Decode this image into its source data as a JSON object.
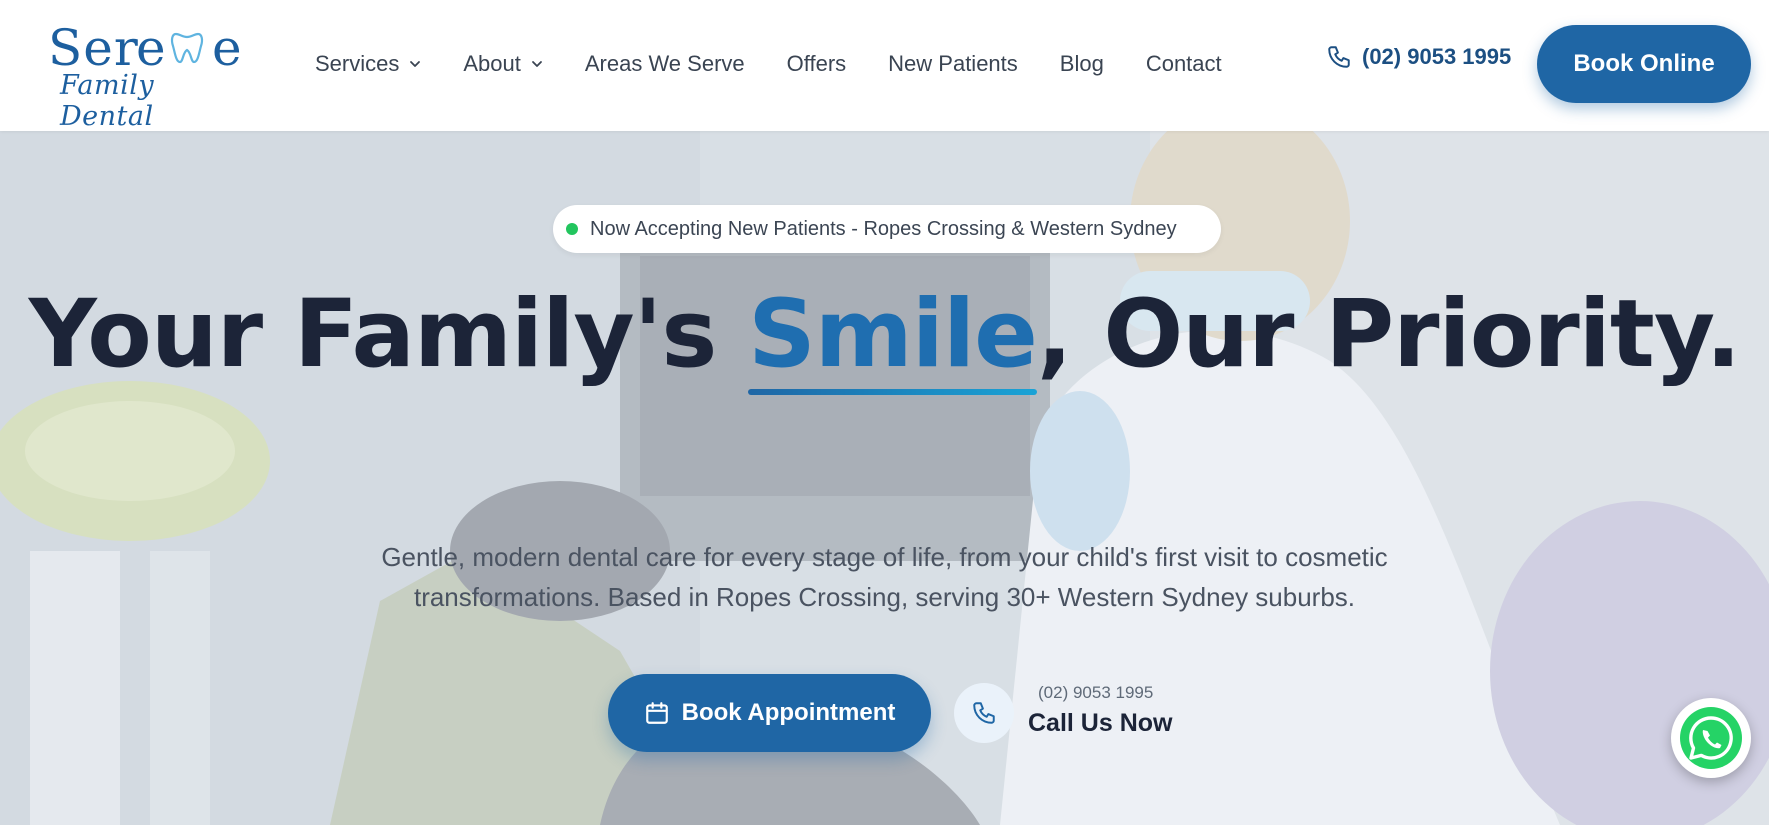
{
  "brand": {
    "logo_word_start": "Ser",
    "logo_word_mid": "e",
    "logo_word_end": "e",
    "logo_tagline": "Family Dental",
    "primary_color": "#1f66a5",
    "accent_color": "#1f6eb0",
    "status_color": "#22c55e"
  },
  "nav": {
    "items": [
      {
        "label": "Services",
        "dropdown": true
      },
      {
        "label": "About",
        "dropdown": true
      },
      {
        "label": "Areas We Serve",
        "dropdown": false
      },
      {
        "label": "Offers",
        "dropdown": false
      },
      {
        "label": "New Patients",
        "dropdown": false
      },
      {
        "label": "Blog",
        "dropdown": false
      },
      {
        "label": "Contact",
        "dropdown": false
      }
    ],
    "phone": "(02) 9053 1995",
    "phone_icon": "phone-icon",
    "book_online_label": "Book Online"
  },
  "hero": {
    "badge_text": "Now Accepting New Patients - Ropes Crossing & Western Sydney",
    "headline_before": "Your Family's ",
    "headline_accent": "Smile",
    "headline_after": ", Our Priority.",
    "subheading": "Gentle, modern dental care for every stage of life, from your child's first visit to cosmetic transformations. Based in Ropes Crossing, serving 30+ Western Sydney suburbs.",
    "book_button_label": "Book Appointment",
    "book_button_icon": "calendar-icon",
    "call_number": "(02) 9053 1995",
    "call_label": "Call Us Now",
    "call_icon": "phone-icon"
  },
  "floating": {
    "whatsapp_icon": "whatsapp-icon"
  }
}
